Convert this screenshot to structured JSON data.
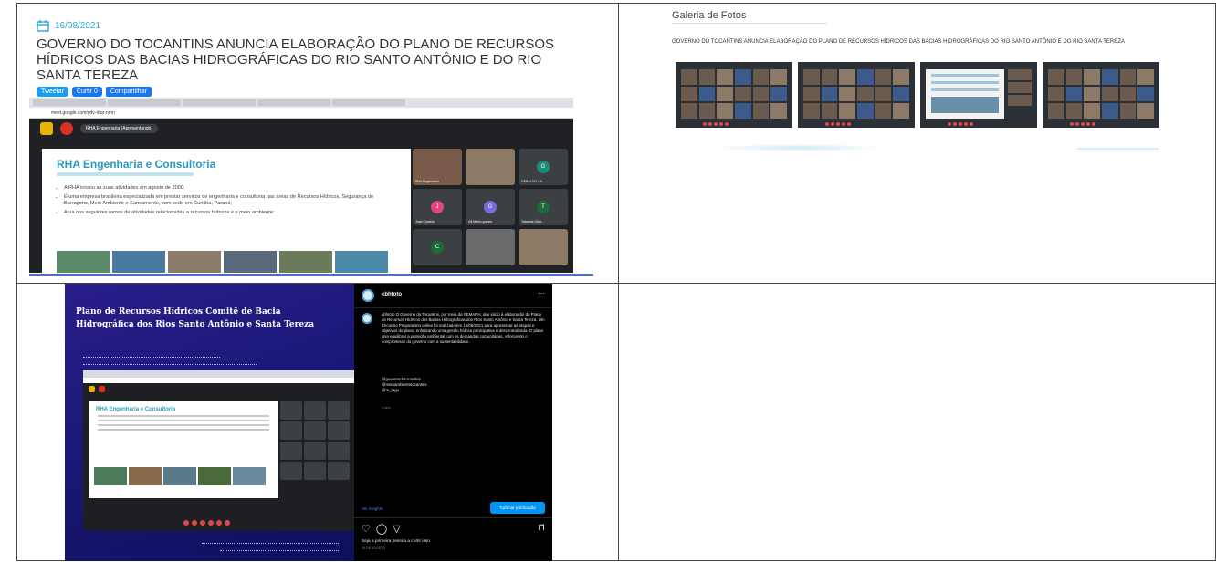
{
  "news": {
    "date": "16/08/2021",
    "title": "GOVERNO DO TOCANTINS ANUNCIA ELABORAÇÃO DO PLANO DE RECURSOS HÍDRICOS DAS BACIAS HIDROGRÁFICAS DO RIO SANTO ANTÔNIO E DO RIO SANTA TEREZA",
    "share": {
      "tweet": "Tweetar",
      "like": "Curtir 0",
      "share": "Compartilhar"
    },
    "meeting": {
      "presenter_chip": "RHA Engenharia (Apresentando)",
      "url": "meet.google.com/gdv-rbqr-nmn",
      "slide_title": "RHA Engenharia e Consultoria",
      "bullets": [
        "A RHA iniciou as suas atividades em agosto de 2000;",
        "É uma empresa brasileira especializada em prestar serviços de engenharia e consultoria nas áreas de Recursos Hídricos, Segurança de Barragens, Meio Ambiente e Saneamento, com sede em Curitiba, Paraná;",
        "Atua nos seguintes ramos de atividades relacionadas a recursos hídricos e o meio ambiente:"
      ],
      "participants": [
        {
          "initial": "",
          "name": "RHA Engenharia",
          "color": "#7a5a48"
        },
        {
          "initial": "",
          "name": "",
          "color": "#8c7a66"
        },
        {
          "initial": "G",
          "name": "GERALDO LAL...",
          "color": "#1e8a7a"
        },
        {
          "initial": "J",
          "name": "José Cunchio",
          "color": "#e0467a"
        },
        {
          "initial": "G",
          "name": "Gil Melvo gomes",
          "color": "#7a6ad8"
        },
        {
          "initial": "T",
          "name": "Tabarela Olive...",
          "color": "#1e6a3a"
        },
        {
          "initial": "C",
          "name": "",
          "color": "#1e6a3a"
        },
        {
          "initial": "",
          "name": "",
          "color": "#6a6a6a"
        },
        {
          "initial": "",
          "name": "",
          "color": "#8c7a66"
        }
      ]
    }
  },
  "gallery": {
    "heading": "Galeria de Fotos",
    "title": "GOVERNO DO TOCANTINS ANUNCIA ELABORAÇÃO DO PLANO DE RECURSOS HÍDRICOS DAS BACIAS HIDROGRÁFICAS DO RIO SANTO ANTÔNIO E DO RIO SANTA TEREZA"
  },
  "instagram": {
    "slide_title": "Plano de Recursos Hídricos Comitê de Bacia Hidrográfica dos Rios Santo Antônio e Santa Tereza",
    "mini_slide_title": "RHA Engenharia e Consultoria",
    "username": "cbhtoto",
    "more": "···",
    "caption": "cbhtoto O Governo do Tocantins, por meio da SEMARH, deu início à elaboração do Plano de Recursos Hídricos das Bacias Hidrográficas dos Rios Santo Antônio e Santa Tereza. Um Encontro Preparatório online foi realizado em 15/08/2021 para apresentar as etapas e objetivos do plano, enfatizando uma gestão hídrica participativa e descentralizada. O plano visa equilibrar a proteção ambiental com as demandas comunitárias, reforçando o compromisso do governo com a sustentabilidade.",
    "tags": [
      "@governodotocantins",
      "@meioambientetocantins",
      "@rc_tago"
    ],
    "time": "1 sem",
    "insights": "Ver insights",
    "boost": "Turbinar publicação",
    "like_text": "Seja a primeira pessoa a curtir isso",
    "date": "16 DE AGOSTO"
  },
  "colors": {
    "accent_blue": "#2ea6d8",
    "ig_boost": "#0095f6",
    "slide_purple": "#1b1878"
  }
}
